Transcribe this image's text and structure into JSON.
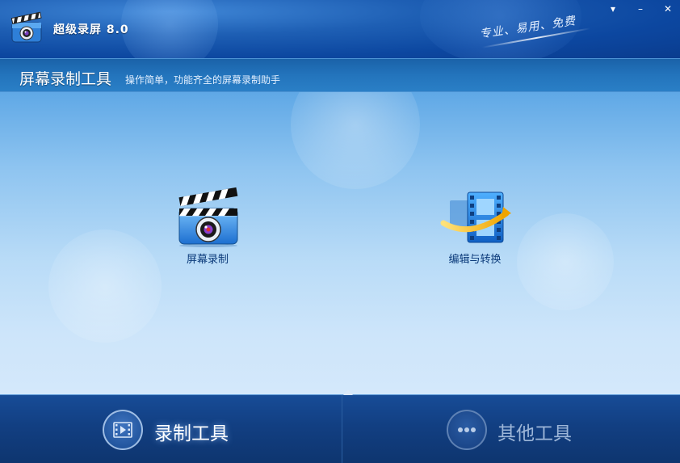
{
  "app": {
    "title": "超级录屏 8.0",
    "slogan": "专业、易用、免费"
  },
  "window_controls": {
    "menu": "▾",
    "minimize": "–",
    "close": "✕"
  },
  "subheader": {
    "title": "屏幕录制工具",
    "description": "操作简单，功能齐全的屏幕录制助手"
  },
  "tools": [
    {
      "label": "屏幕录制",
      "icon": "clapperboard-camera-icon"
    },
    {
      "label": "编辑与转换",
      "icon": "film-convert-icon"
    }
  ],
  "bottom_nav": [
    {
      "label": "录制工具",
      "icon": "video-film-icon",
      "active": true
    },
    {
      "label": "其他工具",
      "icon": "more-dots-icon",
      "active": false
    }
  ],
  "colors": {
    "title_bar": "#0c47a0",
    "subheader": "#2374bc",
    "bottom_bar": "#123f82",
    "label_text": "#0b3a7a"
  }
}
